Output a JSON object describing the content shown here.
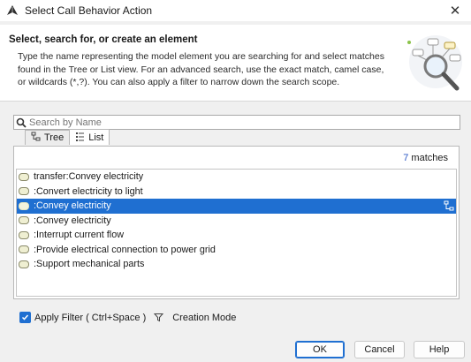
{
  "window": {
    "title": "Select Call Behavior Action",
    "app_icon": "magicdraw-app-icon",
    "close_icon": "close-icon"
  },
  "header": {
    "title": "Select, search for, or create an element",
    "description": "Type the name representing the model element you are searching for and select matches found in the Tree or List view. For an advanced search, use the exact match, camel case, or wildcards (*,?). You can also apply a filter to narrow down the search scope."
  },
  "search": {
    "placeholder": "Search by Name",
    "value": "",
    "icon": "search-icon"
  },
  "tabs": [
    {
      "label": "Tree",
      "icon": "tree-view-icon",
      "active": false
    },
    {
      "label": "List",
      "icon": "list-view-icon",
      "active": true
    }
  ],
  "results": {
    "count": "7",
    "count_suffix": "matches",
    "items": [
      {
        "label": "transfer:Convey electricity",
        "icon": "activity-icon"
      },
      {
        "label": ":Convert electricity to light",
        "icon": "activity-icon"
      },
      {
        "label": ":Convey electricity",
        "icon": "activity-icon",
        "selected": true,
        "action_icon": "show-in-tree-icon"
      },
      {
        "label": ":Convey electricity",
        "icon": "activity-icon"
      },
      {
        "label": ":Interrupt current flow",
        "icon": "activity-icon"
      },
      {
        "label": ":Provide electrical connection to power grid",
        "icon": "activity-icon"
      },
      {
        "label": ":Support mechanical parts",
        "icon": "activity-icon"
      }
    ]
  },
  "options": {
    "apply_filter_label": "Apply Filter ( Ctrl+Space )",
    "apply_filter_checked": true,
    "filter_icon": "filter-funnel-icon",
    "creation_mode_label": "Creation Mode"
  },
  "buttons": {
    "ok": "OK",
    "cancel": "Cancel",
    "help": "Help"
  },
  "colors": {
    "selection": "#1f6fd1",
    "match_count": "#2b57c4",
    "checkbox": "#1f6fd1"
  }
}
